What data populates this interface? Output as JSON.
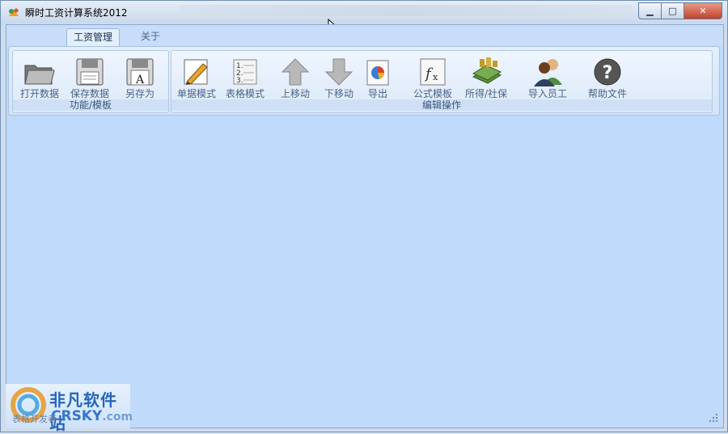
{
  "window": {
    "title": "瞬时工资计算系统2012",
    "controls": {
      "minimize": "▁",
      "maximize": "□",
      "close": "✕"
    }
  },
  "tabs": [
    {
      "label": "工资管理",
      "active": true
    },
    {
      "label": "关于",
      "active": false
    }
  ],
  "ribbon": {
    "groups": [
      {
        "label": "功能/模板",
        "buttons": [
          {
            "label": "打开数据",
            "icon": "folder-open-icon"
          },
          {
            "label": "保存数据",
            "icon": "floppy-save-icon"
          },
          {
            "label": "另存为",
            "icon": "floppy-save-as-icon"
          }
        ]
      },
      {
        "label": "编辑操作",
        "buttons": [
          {
            "label": "单据模式",
            "icon": "pencil-note-icon"
          },
          {
            "label": "表格模式",
            "icon": "numbered-list-icon"
          },
          {
            "label": "上移动",
            "icon": "arrow-up-icon"
          },
          {
            "label": "下移动",
            "icon": "arrow-down-icon"
          },
          {
            "label": "导出",
            "icon": "export-chart-icon"
          },
          {
            "label": "公式模板",
            "icon": "formula-fx-icon"
          },
          {
            "label": "所得/社保",
            "icon": "money-stack-icon"
          },
          {
            "label": "导入员工",
            "icon": "users-icon"
          },
          {
            "label": "帮助文件",
            "icon": "help-icon"
          }
        ]
      }
    ]
  },
  "status": {
    "text": "表格开发者"
  },
  "watermark": {
    "cn": "非凡软件站",
    "en": "CRSKY",
    "domain": ".com"
  },
  "colors": {
    "client_bg": "#c0dafc",
    "ribbon_bg": "#dce9f9",
    "close_red": "#c2412a"
  }
}
